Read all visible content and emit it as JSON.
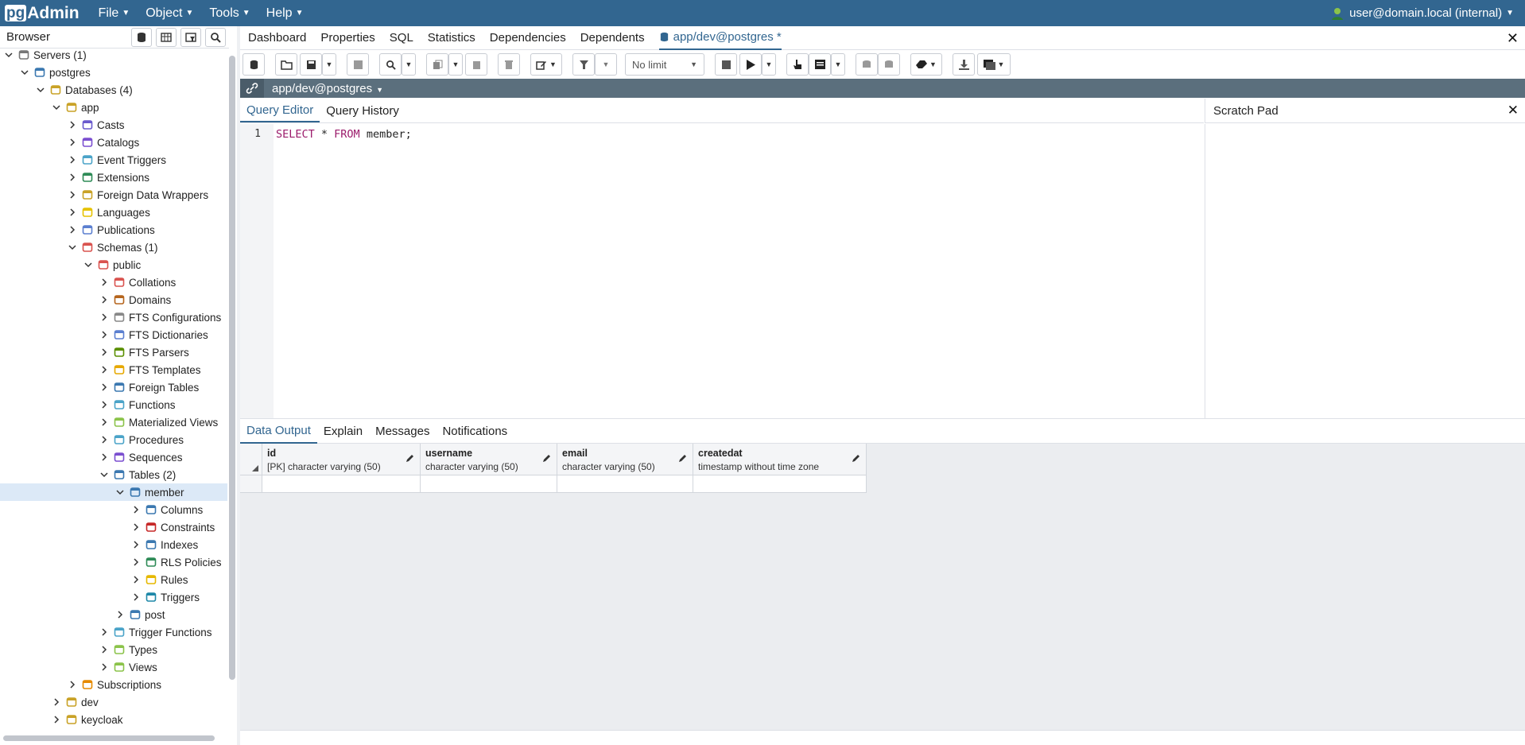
{
  "navbar": {
    "brand_pg": "pg",
    "brand_rest": "Admin",
    "menus": [
      {
        "label": "File"
      },
      {
        "label": "Object"
      },
      {
        "label": "Tools"
      },
      {
        "label": "Help"
      }
    ],
    "user": "user@domain.local (internal)"
  },
  "browser": {
    "title": "Browser",
    "tools": [
      "query-tool-icon",
      "view-data-icon",
      "filtered-rows-icon",
      "search-icon"
    ]
  },
  "tree": [
    {
      "label": "Servers (1)",
      "icon": "servers-icon",
      "expanded": true
    },
    {
      "label": "postgres",
      "icon": "server-icon",
      "expanded": true
    },
    {
      "label": "Databases (4)",
      "icon": "databases-icon",
      "expanded": true
    },
    {
      "label": "app",
      "icon": "database-icon",
      "expanded": true
    },
    {
      "label": "Casts",
      "icon": "casts-icon"
    },
    {
      "label": "Catalogs",
      "icon": "catalogs-icon"
    },
    {
      "label": "Event Triggers",
      "icon": "event-triggers-icon"
    },
    {
      "label": "Extensions",
      "icon": "extensions-icon"
    },
    {
      "label": "Foreign Data Wrappers",
      "icon": "fdw-icon"
    },
    {
      "label": "Languages",
      "icon": "languages-icon"
    },
    {
      "label": "Publications",
      "icon": "publications-icon"
    },
    {
      "label": "Schemas (1)",
      "icon": "schemas-icon",
      "expanded": true
    },
    {
      "label": "public",
      "icon": "schema-icon",
      "expanded": true
    },
    {
      "label": "Collations",
      "icon": "collations-icon"
    },
    {
      "label": "Domains",
      "icon": "domains-icon"
    },
    {
      "label": "FTS Configurations",
      "icon": "fts-config-icon"
    },
    {
      "label": "FTS Dictionaries",
      "icon": "fts-dict-icon"
    },
    {
      "label": "FTS Parsers",
      "icon": "fts-parser-icon"
    },
    {
      "label": "FTS Templates",
      "icon": "fts-template-icon"
    },
    {
      "label": "Foreign Tables",
      "icon": "foreign-tables-icon"
    },
    {
      "label": "Functions",
      "icon": "functions-icon"
    },
    {
      "label": "Materialized Views",
      "icon": "mviews-icon"
    },
    {
      "label": "Procedures",
      "icon": "procedures-icon"
    },
    {
      "label": "Sequences",
      "icon": "sequences-icon"
    },
    {
      "label": "Tables (2)",
      "icon": "tables-icon",
      "expanded": true
    },
    {
      "label": "member",
      "icon": "table-icon",
      "expanded": true,
      "selected": true
    },
    {
      "label": "Columns",
      "icon": "columns-icon"
    },
    {
      "label": "Constraints",
      "icon": "constraints-icon"
    },
    {
      "label": "Indexes",
      "icon": "indexes-icon"
    },
    {
      "label": "RLS Policies",
      "icon": "rls-policies-icon"
    },
    {
      "label": "Rules",
      "icon": "rules-icon"
    },
    {
      "label": "Triggers",
      "icon": "triggers-icon"
    },
    {
      "label": "post",
      "icon": "table-icon"
    },
    {
      "label": "Trigger Functions",
      "icon": "trigger-functions-icon"
    },
    {
      "label": "Types",
      "icon": "types-icon"
    },
    {
      "label": "Views",
      "icon": "views-icon"
    },
    {
      "label": "Subscriptions",
      "icon": "subscriptions-icon"
    },
    {
      "label": "dev",
      "icon": "database-icon"
    },
    {
      "label": "keycloak",
      "icon": "database-icon"
    }
  ],
  "tabs": [
    {
      "label": "Dashboard"
    },
    {
      "label": "Properties"
    },
    {
      "label": "SQL"
    },
    {
      "label": "Statistics"
    },
    {
      "label": "Dependencies"
    },
    {
      "label": "Dependents"
    },
    {
      "label": "app/dev@postgres *",
      "active": true
    }
  ],
  "toolbar": {
    "limit": "No limit"
  },
  "connection": {
    "label": "app/dev@postgres"
  },
  "editor": {
    "tabs": [
      {
        "label": "Query Editor",
        "active": true
      },
      {
        "label": "Query History"
      }
    ],
    "line_number": "1",
    "code": {
      "k1": "SELECT",
      "rest1": " * ",
      "k2": "FROM",
      "rest2": " member;"
    }
  },
  "scratch": {
    "title": "Scratch Pad"
  },
  "output": {
    "tabs": [
      {
        "label": "Data Output",
        "active": true
      },
      {
        "label": "Explain"
      },
      {
        "label": "Messages"
      },
      {
        "label": "Notifications"
      }
    ],
    "columns": [
      {
        "name": "id",
        "type": "[PK] character varying (50)"
      },
      {
        "name": "username",
        "type": "character varying (50)"
      },
      {
        "name": "email",
        "type": "character varying (50)"
      },
      {
        "name": "createdat",
        "type": "timestamp without time zone"
      }
    ]
  },
  "colors": {
    "navbar": "#326690",
    "accent": "#326690",
    "keyword": "#9b1b6b",
    "conn_bar": "#5b6f7d"
  }
}
